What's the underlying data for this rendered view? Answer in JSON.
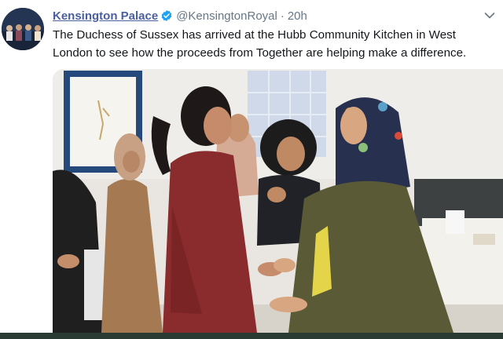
{
  "tweet": {
    "display_name": "Kensington Palace",
    "handle": "@KensingtonRoyal",
    "separator": "·",
    "time": "20h",
    "text": "The Duchess of Sussex has arrived at the Hubb Community Kitchen in West London to see how the proceeds from Together are helping make a difference."
  },
  "icons": {
    "avatar": "avatar-photo",
    "verified": "verified-badge-icon",
    "menu": "chevron-down-icon"
  },
  "colors": {
    "display_name": "#4a5fa0",
    "verified": "#1da1f2",
    "secondary_text": "#657786",
    "body_text": "#14171a"
  }
}
